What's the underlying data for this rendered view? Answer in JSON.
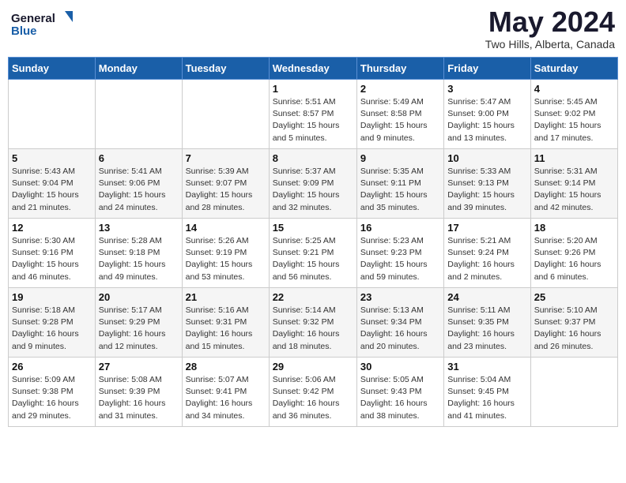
{
  "logo": {
    "line1": "General",
    "line2": "Blue"
  },
  "title": "May 2024",
  "location": "Two Hills, Alberta, Canada",
  "days_header": [
    "Sunday",
    "Monday",
    "Tuesday",
    "Wednesday",
    "Thursday",
    "Friday",
    "Saturday"
  ],
  "weeks": [
    [
      {
        "day": "",
        "info": ""
      },
      {
        "day": "",
        "info": ""
      },
      {
        "day": "",
        "info": ""
      },
      {
        "day": "1",
        "info": "Sunrise: 5:51 AM\nSunset: 8:57 PM\nDaylight: 15 hours\nand 5 minutes."
      },
      {
        "day": "2",
        "info": "Sunrise: 5:49 AM\nSunset: 8:58 PM\nDaylight: 15 hours\nand 9 minutes."
      },
      {
        "day": "3",
        "info": "Sunrise: 5:47 AM\nSunset: 9:00 PM\nDaylight: 15 hours\nand 13 minutes."
      },
      {
        "day": "4",
        "info": "Sunrise: 5:45 AM\nSunset: 9:02 PM\nDaylight: 15 hours\nand 17 minutes."
      }
    ],
    [
      {
        "day": "5",
        "info": "Sunrise: 5:43 AM\nSunset: 9:04 PM\nDaylight: 15 hours\nand 21 minutes."
      },
      {
        "day": "6",
        "info": "Sunrise: 5:41 AM\nSunset: 9:06 PM\nDaylight: 15 hours\nand 24 minutes."
      },
      {
        "day": "7",
        "info": "Sunrise: 5:39 AM\nSunset: 9:07 PM\nDaylight: 15 hours\nand 28 minutes."
      },
      {
        "day": "8",
        "info": "Sunrise: 5:37 AM\nSunset: 9:09 PM\nDaylight: 15 hours\nand 32 minutes."
      },
      {
        "day": "9",
        "info": "Sunrise: 5:35 AM\nSunset: 9:11 PM\nDaylight: 15 hours\nand 35 minutes."
      },
      {
        "day": "10",
        "info": "Sunrise: 5:33 AM\nSunset: 9:13 PM\nDaylight: 15 hours\nand 39 minutes."
      },
      {
        "day": "11",
        "info": "Sunrise: 5:31 AM\nSunset: 9:14 PM\nDaylight: 15 hours\nand 42 minutes."
      }
    ],
    [
      {
        "day": "12",
        "info": "Sunrise: 5:30 AM\nSunset: 9:16 PM\nDaylight: 15 hours\nand 46 minutes."
      },
      {
        "day": "13",
        "info": "Sunrise: 5:28 AM\nSunset: 9:18 PM\nDaylight: 15 hours\nand 49 minutes."
      },
      {
        "day": "14",
        "info": "Sunrise: 5:26 AM\nSunset: 9:19 PM\nDaylight: 15 hours\nand 53 minutes."
      },
      {
        "day": "15",
        "info": "Sunrise: 5:25 AM\nSunset: 9:21 PM\nDaylight: 15 hours\nand 56 minutes."
      },
      {
        "day": "16",
        "info": "Sunrise: 5:23 AM\nSunset: 9:23 PM\nDaylight: 15 hours\nand 59 minutes."
      },
      {
        "day": "17",
        "info": "Sunrise: 5:21 AM\nSunset: 9:24 PM\nDaylight: 16 hours\nand 2 minutes."
      },
      {
        "day": "18",
        "info": "Sunrise: 5:20 AM\nSunset: 9:26 PM\nDaylight: 16 hours\nand 6 minutes."
      }
    ],
    [
      {
        "day": "19",
        "info": "Sunrise: 5:18 AM\nSunset: 9:28 PM\nDaylight: 16 hours\nand 9 minutes."
      },
      {
        "day": "20",
        "info": "Sunrise: 5:17 AM\nSunset: 9:29 PM\nDaylight: 16 hours\nand 12 minutes."
      },
      {
        "day": "21",
        "info": "Sunrise: 5:16 AM\nSunset: 9:31 PM\nDaylight: 16 hours\nand 15 minutes."
      },
      {
        "day": "22",
        "info": "Sunrise: 5:14 AM\nSunset: 9:32 PM\nDaylight: 16 hours\nand 18 minutes."
      },
      {
        "day": "23",
        "info": "Sunrise: 5:13 AM\nSunset: 9:34 PM\nDaylight: 16 hours\nand 20 minutes."
      },
      {
        "day": "24",
        "info": "Sunrise: 5:11 AM\nSunset: 9:35 PM\nDaylight: 16 hours\nand 23 minutes."
      },
      {
        "day": "25",
        "info": "Sunrise: 5:10 AM\nSunset: 9:37 PM\nDaylight: 16 hours\nand 26 minutes."
      }
    ],
    [
      {
        "day": "26",
        "info": "Sunrise: 5:09 AM\nSunset: 9:38 PM\nDaylight: 16 hours\nand 29 minutes."
      },
      {
        "day": "27",
        "info": "Sunrise: 5:08 AM\nSunset: 9:39 PM\nDaylight: 16 hours\nand 31 minutes."
      },
      {
        "day": "28",
        "info": "Sunrise: 5:07 AM\nSunset: 9:41 PM\nDaylight: 16 hours\nand 34 minutes."
      },
      {
        "day": "29",
        "info": "Sunrise: 5:06 AM\nSunset: 9:42 PM\nDaylight: 16 hours\nand 36 minutes."
      },
      {
        "day": "30",
        "info": "Sunrise: 5:05 AM\nSunset: 9:43 PM\nDaylight: 16 hours\nand 38 minutes."
      },
      {
        "day": "31",
        "info": "Sunrise: 5:04 AM\nSunset: 9:45 PM\nDaylight: 16 hours\nand 41 minutes."
      },
      {
        "day": "",
        "info": ""
      }
    ]
  ]
}
